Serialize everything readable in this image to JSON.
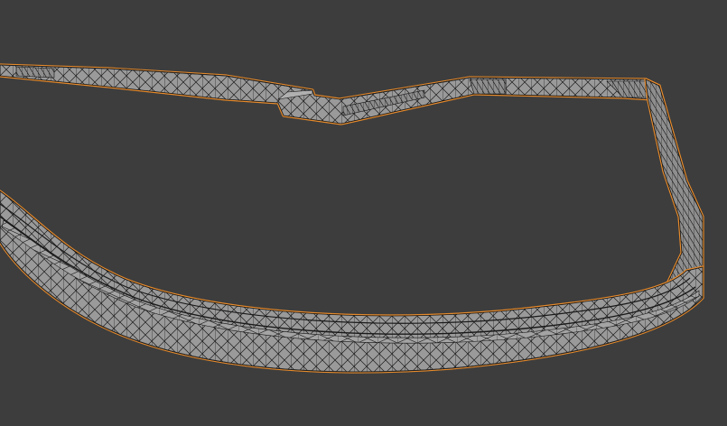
{
  "viewport": {
    "background": "#3d3d3d",
    "selection_outline_color": "#e58a2c",
    "mesh_fill_color": "#9a9a9a",
    "mesh_wire_color": "#1a1a1a",
    "shading_mode": "wireframe-over-solid",
    "selected_object": "track-wall-mesh"
  }
}
